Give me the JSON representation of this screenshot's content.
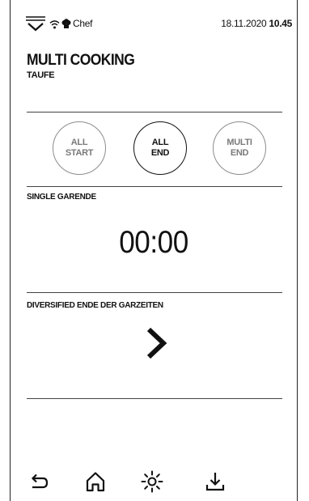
{
  "statusbar": {
    "user": "Chef",
    "date": "18.11.2020",
    "time": "10.45",
    "icons": [
      "menu-icon",
      "wifi-icon",
      "chef-hat-icon"
    ]
  },
  "header": {
    "title": "MULTI COOKING",
    "subtitle": "TAUFE"
  },
  "mode_buttons": [
    {
      "line1": "ALL",
      "line2": "START",
      "selected": false
    },
    {
      "line1": "ALL",
      "line2": "END",
      "selected": true
    },
    {
      "line1": "MULTI",
      "line2": "END",
      "selected": false
    }
  ],
  "single_end": {
    "label": "SINGLE GARENDE",
    "timer": "00:00"
  },
  "diversified": {
    "label": "DIVERSIFIED ENDE DER GARZEITEN",
    "icon": "chevron-right-icon"
  },
  "bottom_nav": {
    "icons": [
      "back-icon",
      "home-icon",
      "light-icon",
      "download-icon"
    ]
  },
  "colors": {
    "text": "#111111",
    "inactive": "#7a7a7a",
    "divider": "#444444",
    "background": "#ffffff"
  }
}
